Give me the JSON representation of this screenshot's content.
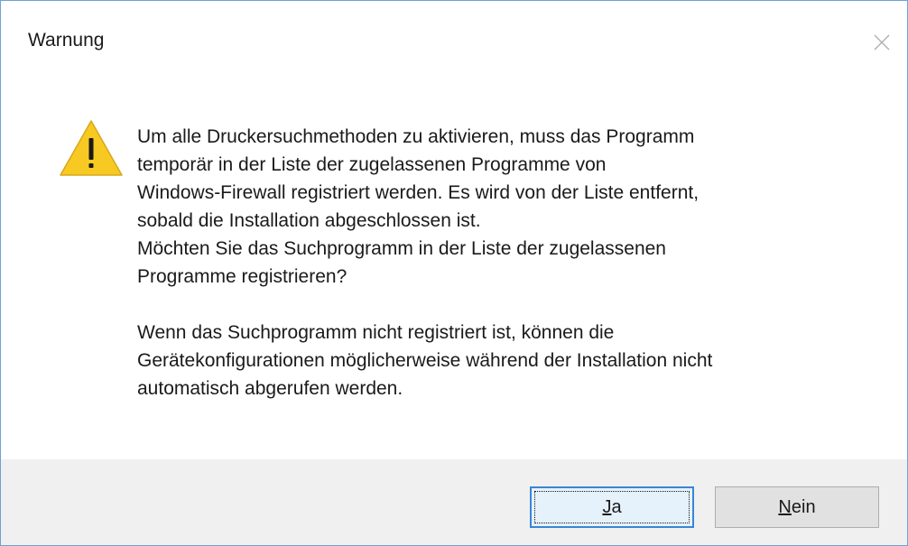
{
  "window": {
    "title": "Warnung"
  },
  "icon": {
    "name": "warning-icon",
    "color": "#f7c922"
  },
  "message": {
    "paragraph1": "Um alle Druckersuchmethoden zu aktivieren, muss das Programm\ntemporär in der Liste der zugelassenen Programme von\nWindows-Firewall registriert werden. Es wird von der Liste entfernt,\nsobald die Installation abgeschlossen ist.\nMöchten Sie das Suchprogramm in der Liste der zugelassenen\nProgramme registrieren?",
    "paragraph2": "Wenn das Suchprogramm nicht registriert ist, können die\nGerätekonfigurationen möglicherweise während der Installation nicht\nautomatisch abgerufen werden."
  },
  "buttons": {
    "yes_mnemonic": "J",
    "yes_rest": "a",
    "no_mnemonic": "N",
    "no_rest": "ein"
  },
  "colors": {
    "window_border": "#6ba3d6",
    "footer_bg": "#f0f0f0",
    "default_button_border": "#3a85d6"
  }
}
